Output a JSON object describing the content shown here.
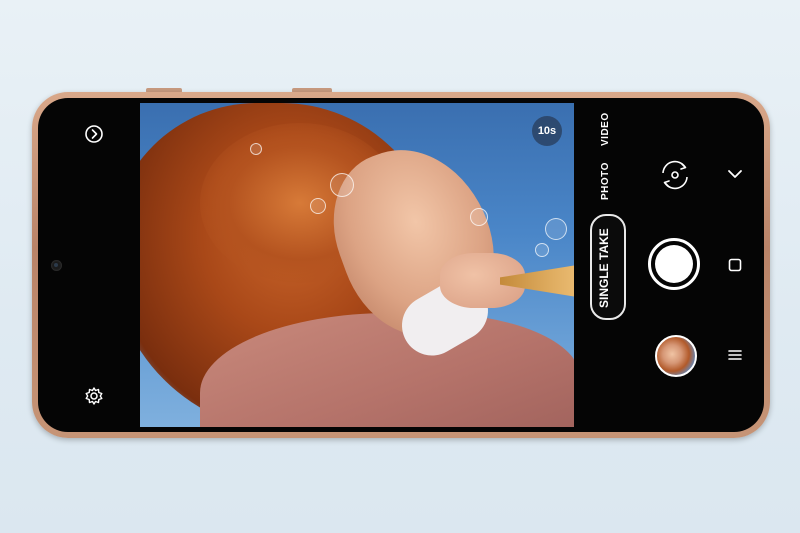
{
  "viewfinder": {
    "timer": "10s"
  },
  "modes": {
    "video": "VIDEO",
    "photo": "PHOTO",
    "single_take": "SINGLE TAKE"
  },
  "icons": {
    "top_left": "expand-circle-icon",
    "bottom_left": "settings-gear-icon",
    "flip": "flip-camera-icon",
    "chevron": "chevron-down-icon",
    "square": "square-icon",
    "menu": "menu-icon"
  },
  "colors": {
    "phone_frame": "#c69476",
    "screen": "#050505",
    "accent_white": "#ffffff"
  }
}
